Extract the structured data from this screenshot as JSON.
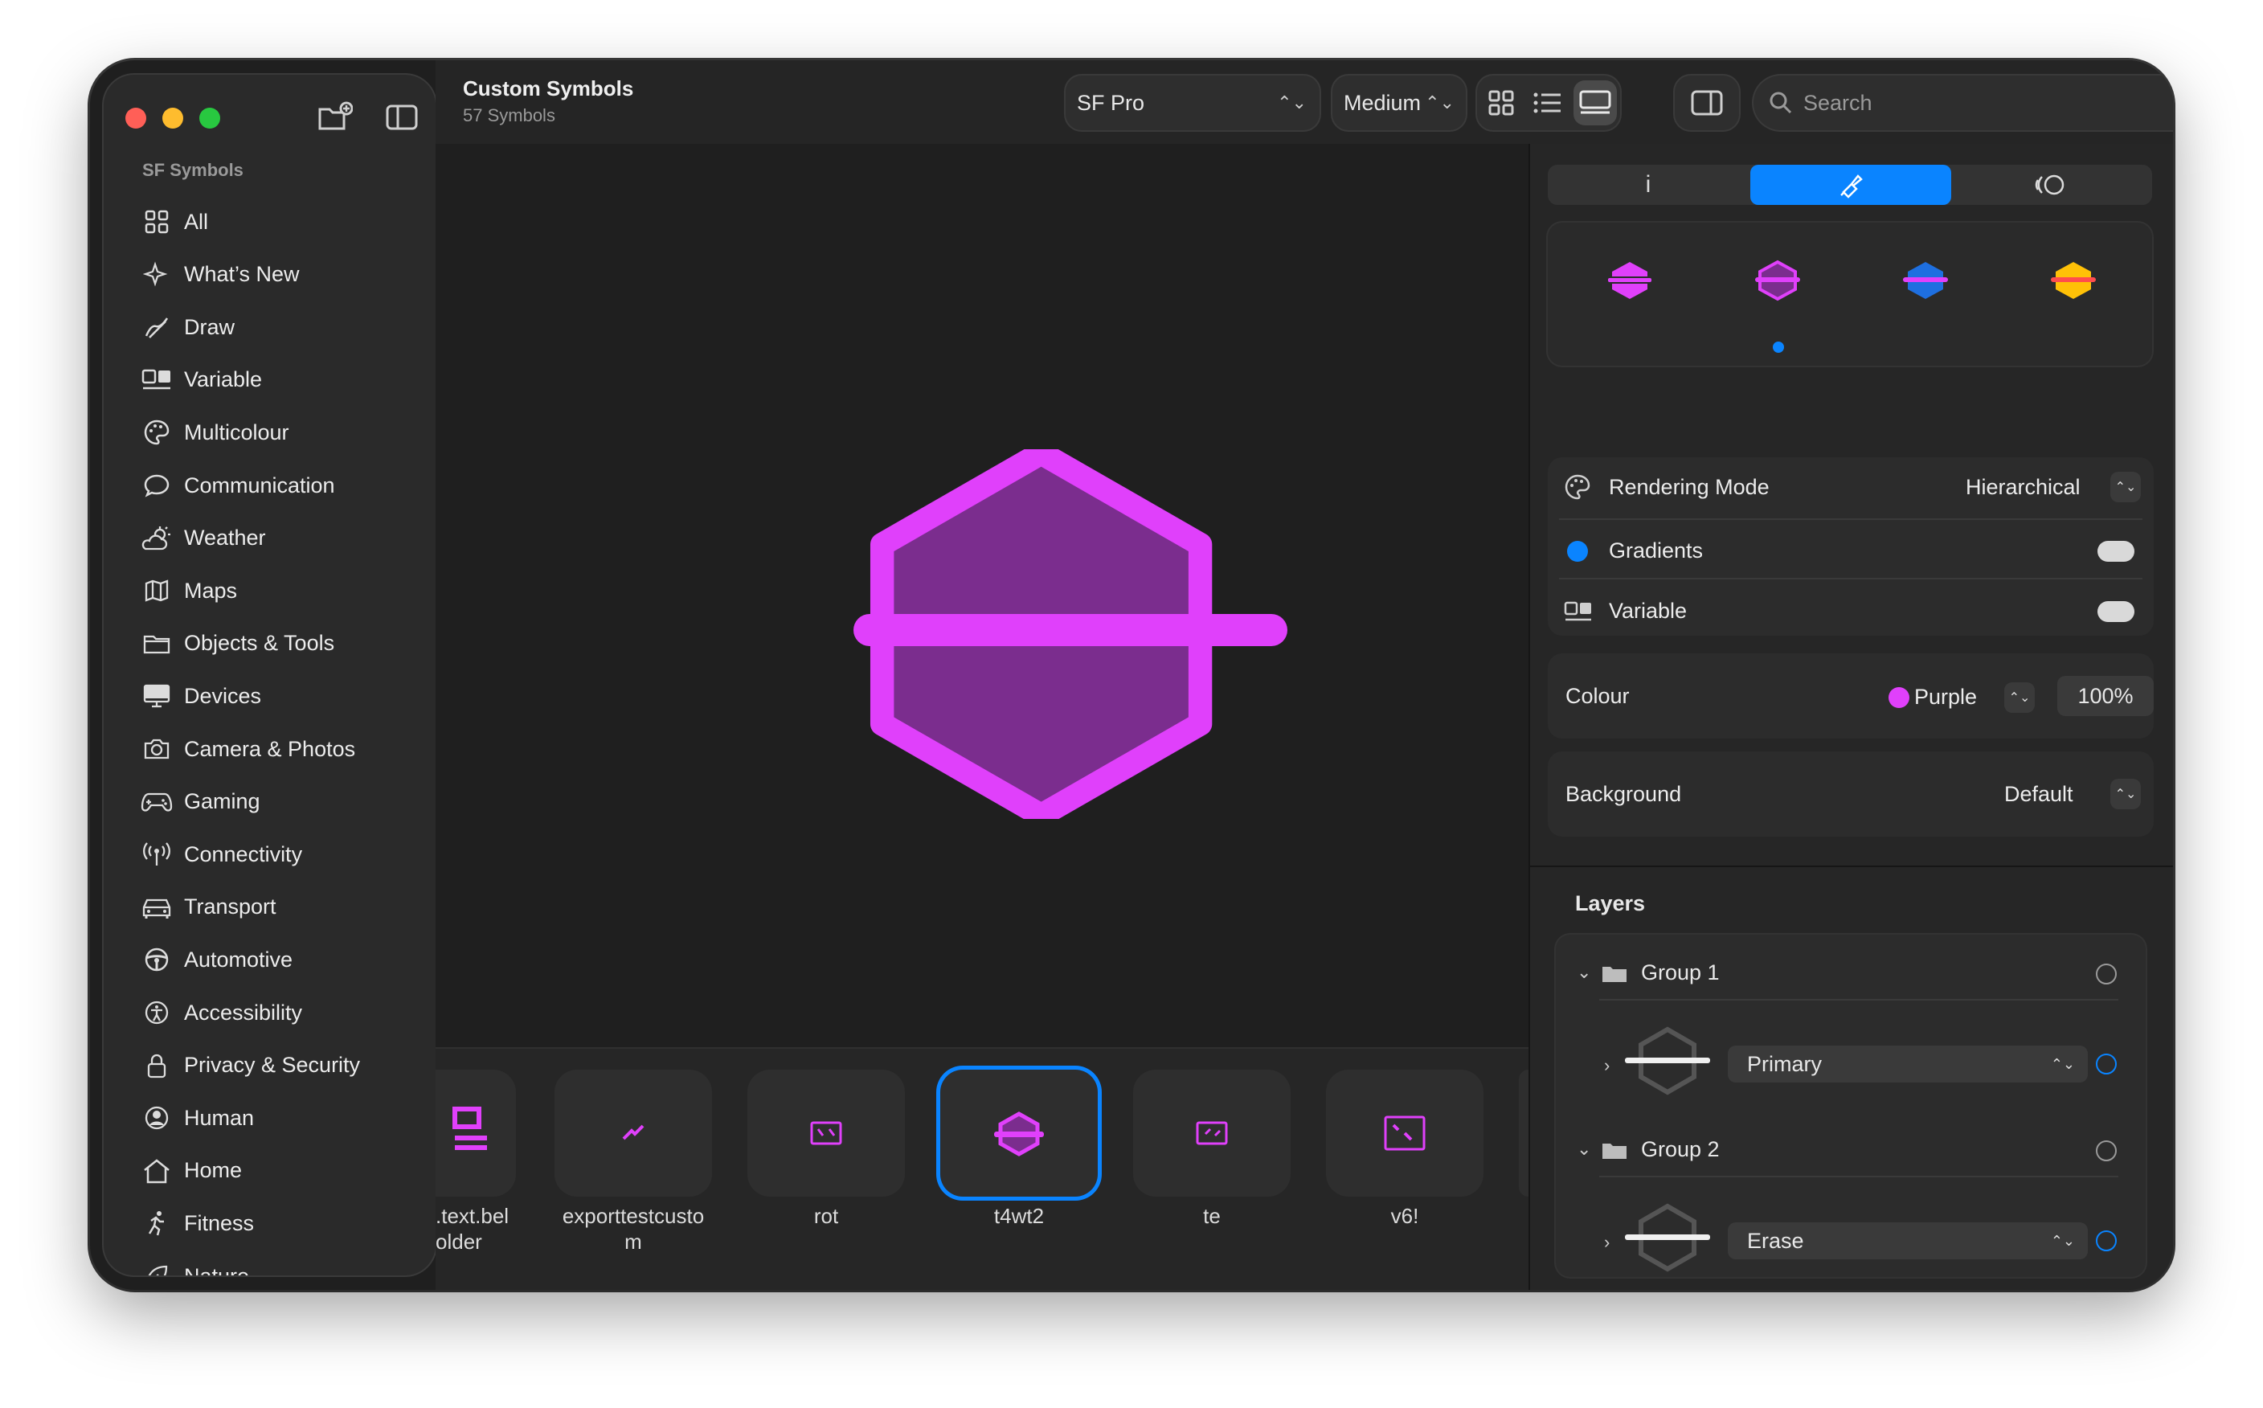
{
  "window": {
    "title": "Custom Symbols",
    "subtitle": "57 Symbols"
  },
  "sidebar": {
    "section_title": "SF Symbols",
    "items": [
      {
        "label": "All",
        "icon": "grid-icon"
      },
      {
        "label": "What’s New",
        "icon": "sparkles-icon"
      },
      {
        "label": "Draw",
        "icon": "draw-icon"
      },
      {
        "label": "Variable",
        "icon": "variable-icon"
      },
      {
        "label": "Multicolour",
        "icon": "palette-icon"
      },
      {
        "label": "Communication",
        "icon": "message-icon"
      },
      {
        "label": "Weather",
        "icon": "cloud-sun-icon"
      },
      {
        "label": "Maps",
        "icon": "map-icon"
      },
      {
        "label": "Objects & Tools",
        "icon": "folder-icon"
      },
      {
        "label": "Devices",
        "icon": "display-icon"
      },
      {
        "label": "Camera & Photos",
        "icon": "camera-icon"
      },
      {
        "label": "Gaming",
        "icon": "gamecontroller-icon"
      },
      {
        "label": "Connectivity",
        "icon": "antenna-icon"
      },
      {
        "label": "Transport",
        "icon": "car-icon"
      },
      {
        "label": "Automotive",
        "icon": "steeringwheel-icon"
      },
      {
        "label": "Accessibility",
        "icon": "accessibility-icon"
      },
      {
        "label": "Privacy & Security",
        "icon": "lock-icon"
      },
      {
        "label": "Human",
        "icon": "person-icon"
      },
      {
        "label": "Home",
        "icon": "house-icon"
      },
      {
        "label": "Fitness",
        "icon": "figure-run-icon"
      },
      {
        "label": "Nature",
        "icon": "leaf-icon"
      }
    ]
  },
  "toolbar": {
    "font_select": "SF Pro",
    "weight_select": "Medium",
    "search_placeholder": "Search"
  },
  "gallery": {
    "items": [
      {
        "label": ".text.bel\nolder"
      },
      {
        "label": "exporttestcusto\nm"
      },
      {
        "label": "rot"
      },
      {
        "label": "t4wt2",
        "selected": true
      },
      {
        "label": "te"
      },
      {
        "label": "v6!"
      }
    ]
  },
  "inspector": {
    "tabs": [
      {
        "icon": "info-icon",
        "glyph": "i"
      },
      {
        "icon": "paintbrush-icon",
        "selected": true
      },
      {
        "icon": "animation-icon"
      }
    ],
    "rendering_mode": {
      "label": "Rendering Mode",
      "value": "Hierarchical"
    },
    "gradients": {
      "label": "Gradients",
      "on": false
    },
    "variable": {
      "label": "Variable",
      "on": false
    },
    "colour": {
      "label": "Colour",
      "value": "Purple",
      "opacity": "100%",
      "swatch": "#e040fb"
    },
    "background": {
      "label": "Background",
      "value": "Default"
    },
    "layers": {
      "title": "Layers",
      "groups": [
        {
          "name": "Group 1",
          "layer": "Primary"
        },
        {
          "name": "Group 2",
          "layer": "Erase"
        }
      ]
    }
  },
  "colors": {
    "accent": "#0a84ff",
    "symbol_primary": "#e040fb",
    "symbol_secondary": "#7b2d8e",
    "traffic_red": "#ff5f57",
    "traffic_yellow": "#febc2e",
    "traffic_green": "#28c840"
  }
}
